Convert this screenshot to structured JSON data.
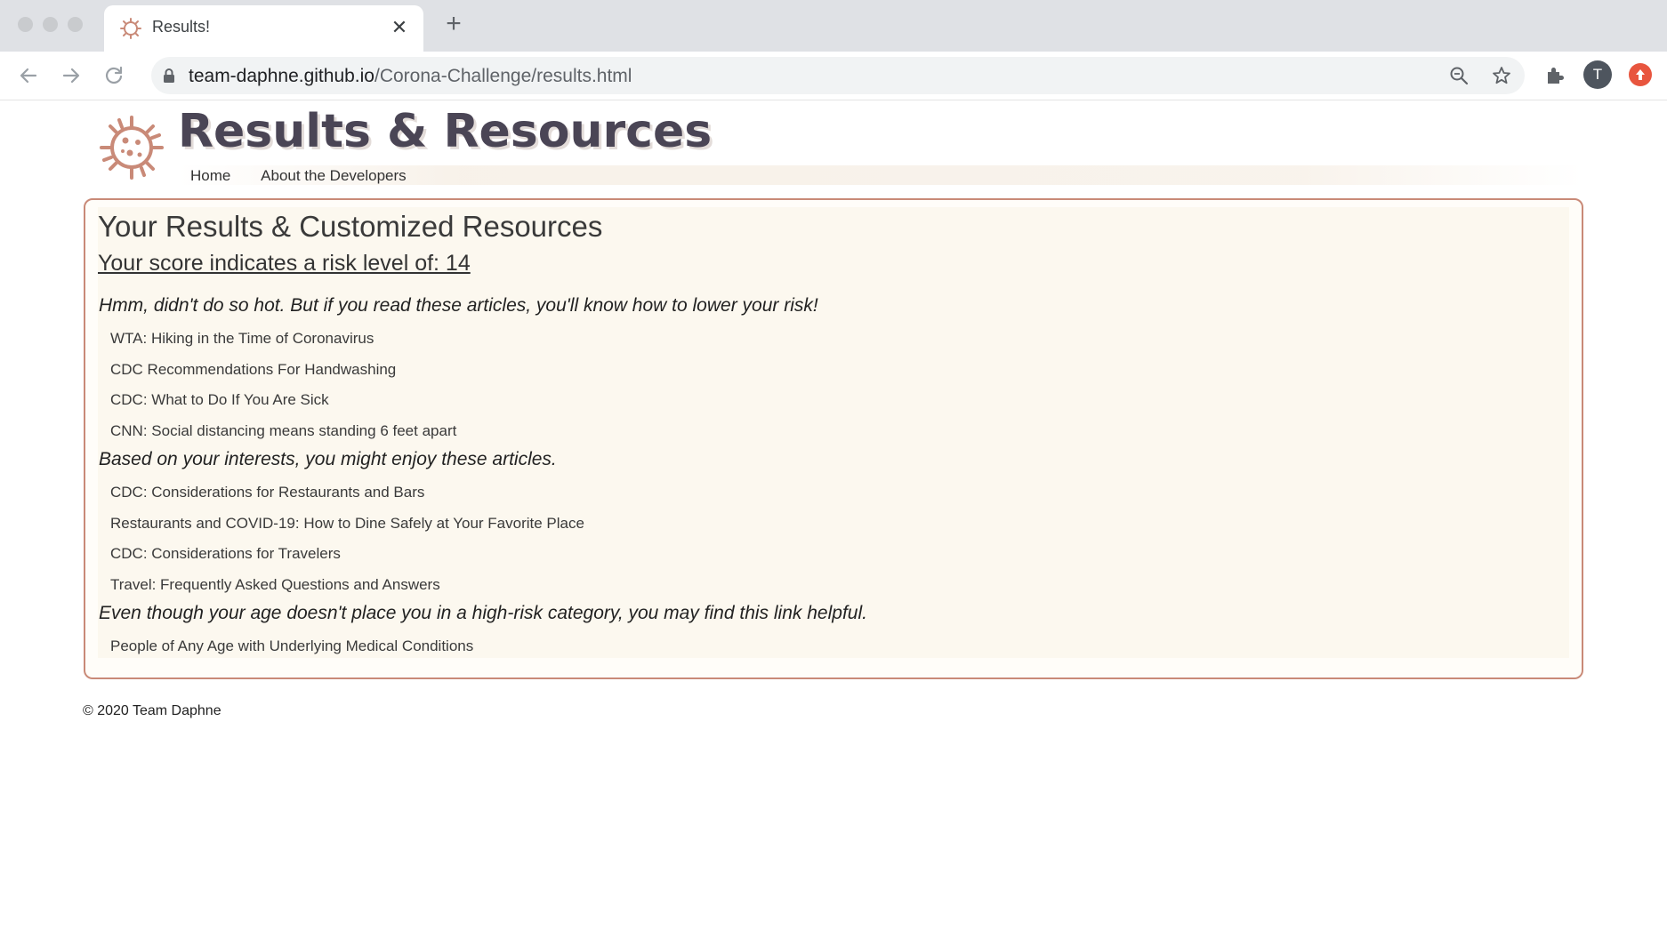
{
  "browser": {
    "tab_title": "Results!",
    "tab_close": "✕",
    "new_tab": "+",
    "url_domain": "team-daphne.github.io",
    "url_path": "/Corona-Challenge/results.html",
    "profile_initial": "T"
  },
  "header": {
    "site_title": "Results & Resources",
    "nav": [
      "Home",
      "About the Developers"
    ]
  },
  "results": {
    "heading": "Your Results & Customized Resources",
    "score_text": "Your score indicates a risk level of: 14",
    "sections": [
      {
        "intro": "Hmm, didn't do so hot. But if you read these articles, you'll know how to lower your risk!",
        "links": [
          "WTA: Hiking in the Time of Coronavirus",
          "CDC Recommendations For Handwashing",
          "CDC: What to Do If You Are Sick",
          "CNN: Social distancing means standing 6 feet apart"
        ]
      },
      {
        "intro": "Based on your interests, you might enjoy these articles.",
        "links": [
          "CDC: Considerations for Restaurants and Bars",
          "Restaurants and COVID-19: How to Dine Safely at Your Favorite Place",
          "CDC: Considerations for Travelers",
          "Travel: Frequently Asked Questions and Answers"
        ]
      },
      {
        "intro": "Even though your age doesn't place you in a high-risk category, you may find this link helpful.",
        "links": [
          "People of Any Age with Underlying Medical Conditions"
        ]
      }
    ]
  },
  "footer": {
    "copyright": "© 2020 Team Daphne"
  },
  "colors": {
    "accent": "#c98a78",
    "title": "#4a4555",
    "card_bg": "#fcf8ef"
  }
}
